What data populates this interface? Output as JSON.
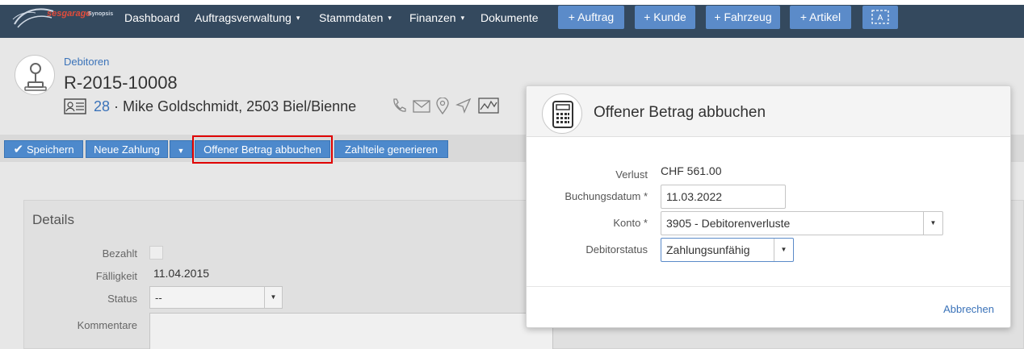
{
  "nav": {
    "logo_text": "sesgarage",
    "logo_sub": "Synopsis",
    "items": [
      {
        "label": "Dashboard",
        "dropdown": false
      },
      {
        "label": "Auftragsverwaltung",
        "dropdown": true
      },
      {
        "label": "Stammdaten",
        "dropdown": true
      },
      {
        "label": "Finanzen",
        "dropdown": true
      },
      {
        "label": "Dokumente",
        "dropdown": false
      }
    ],
    "buttons": [
      "+ Auftrag",
      "+ Kunde",
      "+ Fahrzeug",
      "+ Artikel"
    ],
    "dropdown_caret": "❯"
  },
  "header": {
    "breadcrumb": "Debitoren",
    "title": "R-2015-10008",
    "customer_number": "28",
    "customer_text": "· Mike Goldschmidt, 2503 Biel/Bienne"
  },
  "toolbar": {
    "save": "Speichern",
    "new_payment": "Neue Zahlung",
    "book_open": "Offener Betrag abbuchen",
    "generate_parts": "Zahlteile generieren"
  },
  "details": {
    "title": "Details",
    "paid_label": "Bezahlt",
    "due_label": "Fälligkeit",
    "due_value": "11.04.2015",
    "status_label": "Status",
    "status_value": "--",
    "comments_label": "Kommentare"
  },
  "modal": {
    "title": "Offener Betrag abbuchen",
    "loss_label": "Verlust",
    "loss_value": "CHF 561.00",
    "booking_date_label": "Buchungsdatum *",
    "booking_date_value": "11.03.2022",
    "account_label": "Konto *",
    "account_value": "3905 - Debitorenverluste",
    "debtor_status_label": "Debitorstatus",
    "debtor_status_value": "Zahlungsunfähig",
    "cancel": "Abbrechen"
  },
  "colors": {
    "navbar": "#34495e",
    "nav_button": "#5b8bc9",
    "toolbar_button": "#4d89cc",
    "link": "#3b73b9",
    "highlight": "#e00000"
  }
}
